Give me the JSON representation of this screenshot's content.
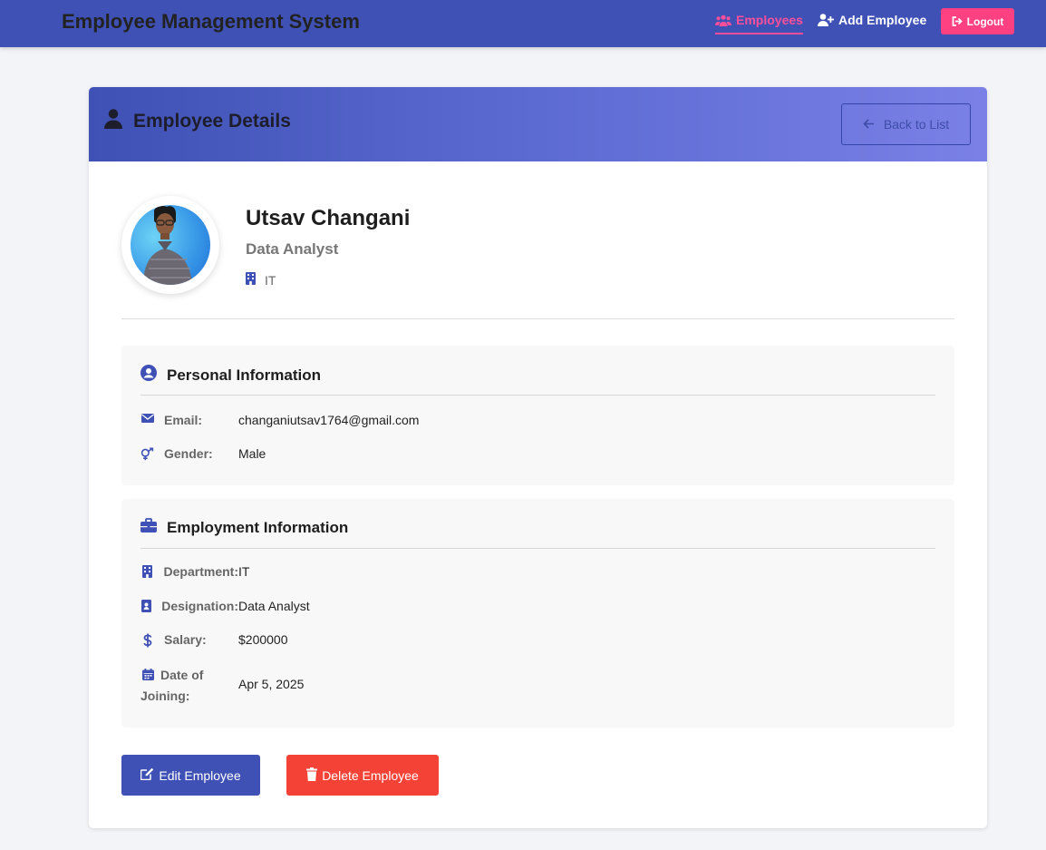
{
  "navbar": {
    "brand": "Employee Management System",
    "employees_label": "Employees",
    "add_employee_label": "Add Employee",
    "logout_label": "Logout"
  },
  "card": {
    "title": "Employee Details",
    "back_label": "Back to List"
  },
  "profile": {
    "name": "Utsav Changani",
    "designation": "Data Analyst",
    "department": "IT"
  },
  "personal": {
    "title": "Personal Information",
    "rows": [
      {
        "label": "Email:",
        "value": "changaniutsav1764@gmail.com",
        "icon": "envelope-icon"
      },
      {
        "label": "Gender:",
        "value": "Male",
        "icon": "gender-icon"
      }
    ]
  },
  "employment": {
    "title": "Employment Information",
    "rows": [
      {
        "label": "Department:",
        "value": "IT",
        "icon": "building-icon"
      },
      {
        "label": "Designation:",
        "value": "Data Analyst",
        "icon": "id-badge-icon"
      },
      {
        "label": "Salary:",
        "value": "$200000",
        "icon": "dollar-icon"
      },
      {
        "label": "Date of Joining:",
        "value": "Apr 5, 2025",
        "icon": "calendar-icon"
      }
    ]
  },
  "actions": {
    "edit_label": "Edit Employee",
    "delete_label": "Delete Employee"
  },
  "colors": {
    "primary": "#3f51b5",
    "accent": "#ff4081",
    "danger": "#f44336"
  }
}
